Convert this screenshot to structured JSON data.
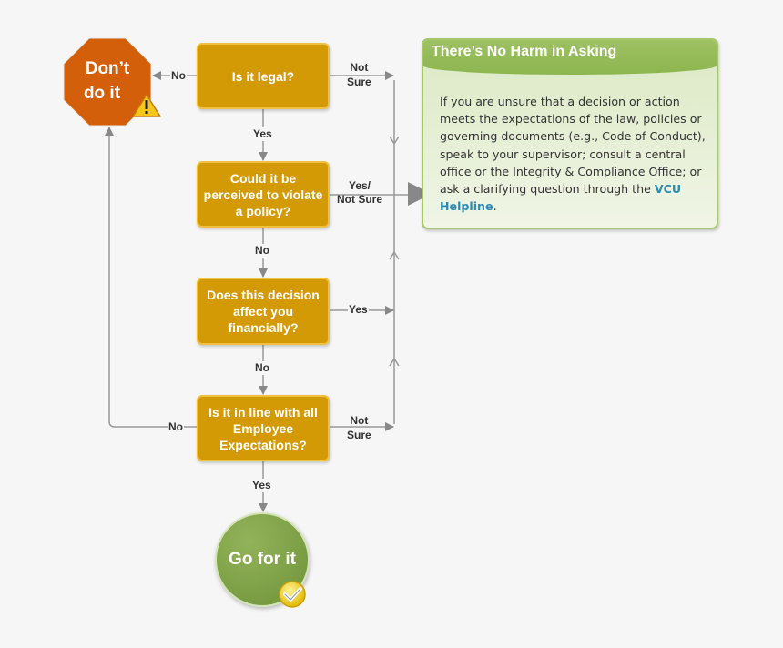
{
  "diagram": {
    "terminals": {
      "stop": {
        "label_line1": "Don’t",
        "label_line2": "do it",
        "icon": "warning-icon",
        "color": "#d35f0a"
      },
      "go": {
        "label": "Go for it",
        "icon": "checkmark-icon",
        "color": "#7a9c42"
      }
    },
    "decisions": [
      {
        "id": "legal",
        "text": "Is it legal?"
      },
      {
        "id": "policy",
        "text": "Could it be perceived to violate a policy?"
      },
      {
        "id": "financial",
        "text": "Does this decision affect you financially?"
      },
      {
        "id": "expectations",
        "text": "Is it in line with all Employee Expectations?"
      }
    ],
    "edge_labels": {
      "legal_no": "No",
      "legal_not_sure_1": "Not",
      "legal_not_sure_2": "Sure",
      "legal_yes": "Yes",
      "policy_yes_1": "Yes/",
      "policy_yes_2": "Not Sure",
      "policy_no": "No",
      "financial_yes": "Yes",
      "financial_no": "No",
      "expectations_no": "No",
      "expectations_not_sure_1": "Not",
      "expectations_not_sure_2": "Sure",
      "expectations_yes": "Yes"
    },
    "info_panel": {
      "title": "There’s No Harm in Asking",
      "body": "If you are unsure that a decision or action meets the expectations of the law, policies or governing documents (e.g., Code of Conduct), speak to your supervisor; consult a central office or the Integrity & Compliance Office; or ask a clarifying question through the ",
      "link_text": "VCU Helpline",
      "body_end": ".",
      "link_color": "#2a8ab0"
    },
    "colors": {
      "decision_fill": "#d49a06",
      "decision_border": "#f0c040",
      "panel_green": "#8cb54f",
      "connector": "#888888"
    }
  }
}
